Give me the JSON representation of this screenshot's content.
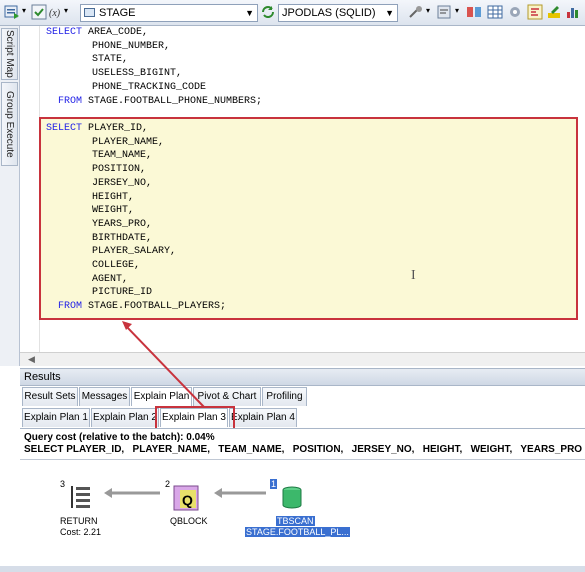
{
  "toolbar": {
    "schema_combo": "STAGE",
    "connection_combo": "JPODLAS (SQLID)"
  },
  "side_tabs": {
    "script_map": "Script Map",
    "group_execute": "Group Execute"
  },
  "editor": {
    "query1": {
      "select_kw": "SELECT",
      "columns": [
        "AREA_CODE,",
        "PHONE_NUMBER,",
        "STATE,",
        "USELESS_BIGINT,",
        "PHONE_TRACKING_CODE"
      ],
      "from_kw": "FROM",
      "table": "STAGE.FOOTBALL_PHONE_NUMBERS;"
    },
    "query2": {
      "select_kw": "SELECT",
      "columns": [
        "PLAYER_ID,",
        "PLAYER_NAME,",
        "TEAM_NAME,",
        "POSITION,",
        "JERSEY_NO,",
        "HEIGHT,",
        "WEIGHT,",
        "YEARS_PRO,",
        "BIRTHDATE,",
        "PLAYER_SALARY,",
        "COLLEGE,",
        "AGENT,",
        "PICTURE_ID"
      ],
      "from_kw": "FROM",
      "table": "STAGE.FOOTBALL_PLAYERS;"
    }
  },
  "results": {
    "title": "Results",
    "tabs": [
      "Result Sets",
      "Messages",
      "Explain Plan",
      "Pivot & Chart",
      "Profiling"
    ],
    "active_tab": "Explain Plan",
    "plan_tabs": [
      "Explain Plan 1",
      "Explain Plan 2",
      "Explain Plan 3",
      "Explain Plan 4"
    ],
    "active_plan_tab": "Explain Plan 3",
    "query_cost": "Query cost (relative to the batch): 0.04%",
    "query_sql": "SELECT PLAYER_ID,   PLAYER_NAME,   TEAM_NAME,   POSITION,   JERSEY_NO,   HEIGHT,   WEIGHT,   YEARS_PRO",
    "nodes": [
      {
        "num": "3",
        "label": "RETURN",
        "cost": "Cost: 2.21",
        "icon": "return-icon"
      },
      {
        "num": "2",
        "label": "QBLOCK",
        "icon": "qblock-icon"
      },
      {
        "num": "1",
        "label": "TBSCAN",
        "table": "STAGE.FOOTBALL_PL...",
        "icon": "table-scan-icon"
      }
    ]
  },
  "colors": {
    "highlight_border": "#c8333d",
    "highlight_fill": "#fbf9d6",
    "keyword": "#1e1ee6",
    "selection": "#3a6fd0"
  }
}
